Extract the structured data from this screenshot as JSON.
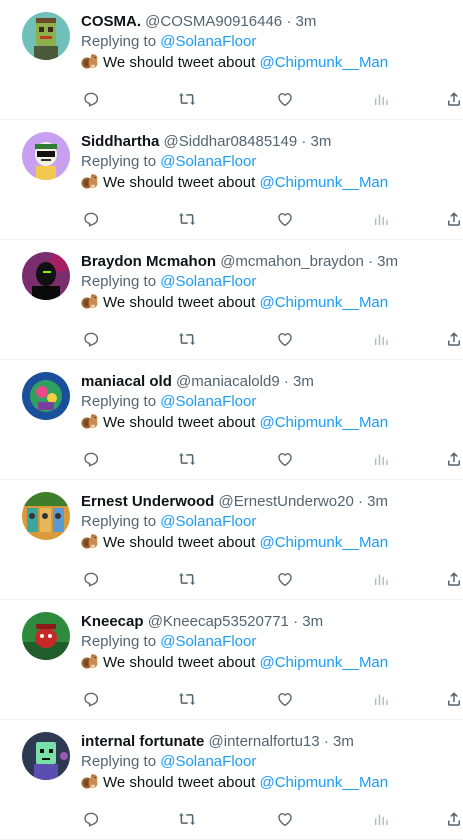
{
  "tweets": [
    {
      "name": "COSMA.",
      "handle": "@COSMA90916446",
      "sep": "·",
      "time": "3m",
      "replying_prefix": "Replying to",
      "replying_to": "@SolanaFloor",
      "text": "We should tweet about",
      "mention": "@Chipmunk__Man",
      "avatar": "cosma-avatar"
    },
    {
      "name": "Siddhartha",
      "handle": "@Siddhar08485149",
      "sep": "·",
      "time": "3m",
      "replying_prefix": "Replying to",
      "replying_to": "@SolanaFloor",
      "text": "We should tweet about",
      "mention": "@Chipmunk__Man",
      "avatar": "siddhartha-avatar"
    },
    {
      "name": "Braydon Mcmahon",
      "handle": "@mcmahon_braydon",
      "sep": "·",
      "time": "3m",
      "replying_prefix": "Replying to",
      "replying_to": "@SolanaFloor",
      "text": "We should tweet about",
      "mention": "@Chipmunk__Man",
      "avatar": "braydon-avatar"
    },
    {
      "name": "maniacal old",
      "handle": "@maniacalold9",
      "sep": "·",
      "time": "3m",
      "replying_prefix": "Replying to",
      "replying_to": "@SolanaFloor",
      "text": "We should tweet about",
      "mention": "@Chipmunk__Man",
      "avatar": "maniacal-avatar"
    },
    {
      "name": "Ernest Underwood",
      "handle": "@ErnestUnderwo20",
      "sep": "·",
      "time": "3m",
      "replying_prefix": "Replying to",
      "replying_to": "@SolanaFloor",
      "text": "We should tweet about",
      "mention": "@Chipmunk__Man",
      "avatar": "ernest-avatar"
    },
    {
      "name": "Kneecap",
      "handle": "@Kneecap53520771",
      "sep": "·",
      "time": "3m",
      "replying_prefix": "Replying to",
      "replying_to": "@SolanaFloor",
      "text": "We should tweet about",
      "mention": "@Chipmunk__Man",
      "avatar": "kneecap-avatar"
    },
    {
      "name": "internal fortunate",
      "handle": "@internalfortu13",
      "sep": "·",
      "time": "3m",
      "replying_prefix": "Replying to",
      "replying_to": "@SolanaFloor",
      "text": "We should tweet about",
      "mention": "@Chipmunk__Man",
      "avatar": "internal-avatar"
    }
  ],
  "icons": {
    "reply": "reply-icon",
    "retweet": "retweet-icon",
    "like": "heart-icon",
    "views": "views-icon",
    "share": "share-icon",
    "emoji": "chipmunk-emoji"
  },
  "colors": {
    "link": "#1d9bf0",
    "secondary": "#536471",
    "text": "#0f1419",
    "divider": "#eff3f4"
  }
}
